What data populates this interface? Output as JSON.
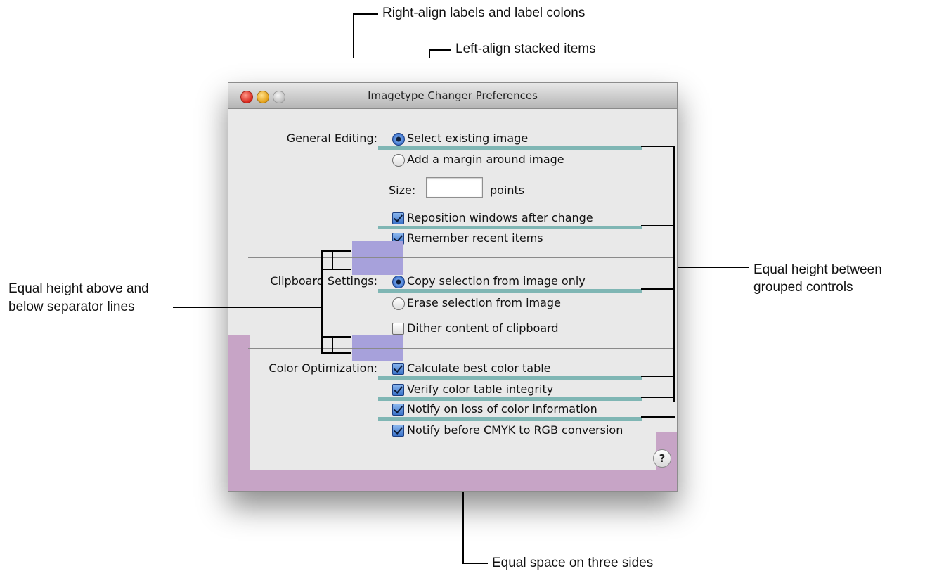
{
  "annotations": {
    "top1": "Right-align labels and label colons",
    "top2": "Left-align stacked items",
    "left": [
      "Equal height above and",
      "below separator lines"
    ],
    "right": [
      "Equal height between",
      "grouped controls"
    ],
    "bottom": "Equal space on three sides"
  },
  "window": {
    "title": "Imagetype Changer Preferences",
    "general": {
      "label": "General Editing:",
      "radio1": "Select existing image",
      "radio2": "Add a margin around image",
      "size_label": "Size:",
      "size_value": "",
      "size_unit": "points",
      "check1": "Reposition windows after change",
      "check2": "Remember recent items"
    },
    "clipboard": {
      "label": "Clipboard Settings:",
      "radio1": "Copy selection from image only",
      "radio2": "Erase selection from image",
      "check1": "Dither content of clipboard"
    },
    "color": {
      "label": "Color Optimization:",
      "check1": "Calculate best color table",
      "check2": "Verify color table integrity",
      "check3": "Notify on loss of color information",
      "check4": "Notify before CMYK to RGB conversion"
    },
    "help": "?"
  }
}
